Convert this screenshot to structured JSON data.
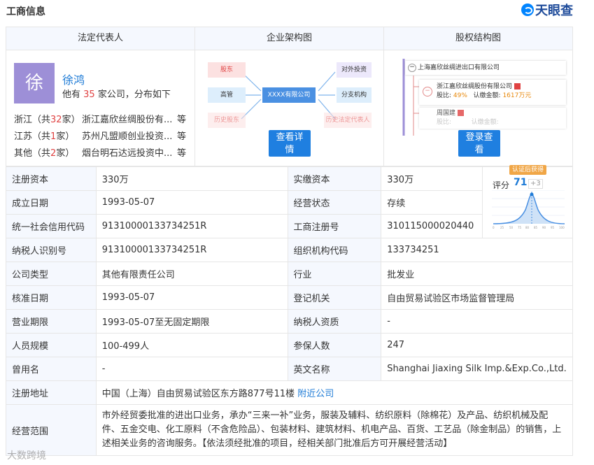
{
  "header": {
    "title": "工商信息",
    "brand": "天眼查"
  },
  "top": {
    "columns": [
      "法定代表人",
      "企业架构图",
      "股权结构图"
    ],
    "rep": {
      "avatar_char": "徐",
      "name": "徐鸿",
      "sub_prefix": "他有",
      "sub_count": "35",
      "sub_suffix": "家公司，分布如下",
      "rows": [
        {
          "province": "浙江",
          "count": "32",
          "company": "浙江嘉欣丝绸股份有...",
          "more": "等"
        },
        {
          "province": "江苏",
          "count": "1",
          "company": "苏州凡盟顺创业投资...",
          "more": "等"
        },
        {
          "province": "其他",
          "count": "2",
          "company": "烟台明石达远投资中...",
          "more": "等"
        }
      ]
    },
    "org": {
      "left": [
        "股东",
        "高管",
        "历史股东"
      ],
      "center": "XXXX有限公司",
      "right": [
        "对外投资",
        "分支机构",
        "历史法定代表人"
      ],
      "button": [
        "查看详",
        "情"
      ]
    },
    "equity": {
      "root": "上海嘉欣丝绸进出口有限公司",
      "holder1": "浙江嘉欣丝绸股份有限公司",
      "holder1_ratio_label": "股比:",
      "holder1_ratio": "49%",
      "holder1_amount_label": "认缴金额:",
      "holder1_amount": "1617万元",
      "holder2": "周国建",
      "holder2_ratio_label": "股比:",
      "holder2_amount_label": "认缴金额:",
      "button": [
        "登录查",
        "看"
      ]
    }
  },
  "score": {
    "badge": "认证后获得",
    "label": "评分",
    "value": "71",
    "delta": "+3"
  },
  "rows": [
    [
      "注册资本",
      "330万",
      "实缴资本",
      "330万"
    ],
    [
      "成立日期",
      "1993-05-07",
      "经营状态",
      "存续"
    ],
    [
      "统一社会信用代码",
      "91310000133734251R",
      "工商注册号",
      "310115000020440"
    ],
    [
      "纳税人识别号",
      "91310000133734251R",
      "组织机构代码",
      "133734251"
    ],
    [
      "公司类型",
      "其他有限责任公司",
      "行业",
      "批发业"
    ],
    [
      "核准日期",
      "1993-05-07",
      "登记机关",
      "自由贸易试验区市场监督管理局"
    ],
    [
      "营业期限",
      "1993-05-07至无固定期限",
      "纳税人资质",
      "-"
    ],
    [
      "人员规模",
      "100-499人",
      "参保人数",
      "247"
    ],
    [
      "曾用名",
      "-",
      "英文名称",
      "Shanghai Jiaxing Silk Imp.&Exp.Co.,Ltd."
    ]
  ],
  "address": {
    "label": "注册地址",
    "value": "中国（上海）自由贸易试验区东方路877号11楼",
    "link": "附近公司"
  },
  "scope": {
    "label": "经营范围",
    "lines": [
      "市外经贸委批准的进出口业务，承办“三来一补”业务，服装及辅料、纺织原料（除棉花）及产品、纺织机械及配",
      "件、五金交电、化工原料（不含危险品）、包装材料、建筑材料、机电产品、百货、工艺品（除金制品）的销售，上",
      "述相关业务的咨询服务。【依法须经批准的项目，经相关部门批准后方可开展经营活动】"
    ]
  },
  "watermark": "大数跨境",
  "colors": {
    "accent": "#1e7bd6",
    "label_bg": "#f5f8fe",
    "button": "#1f7fe0",
    "highlight": "#e04343"
  }
}
